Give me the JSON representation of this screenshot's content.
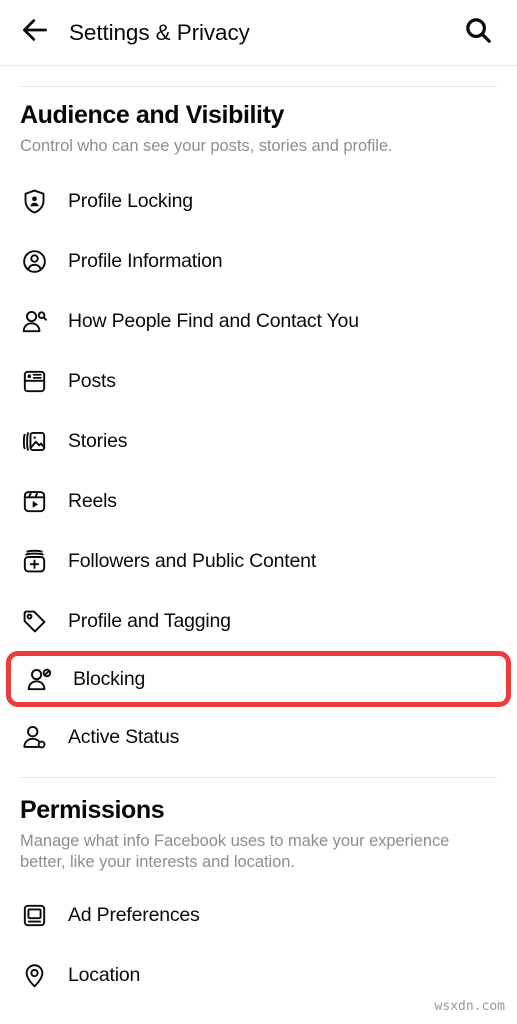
{
  "header": {
    "title": "Settings & Privacy",
    "back_icon": "arrow-left-icon",
    "search_icon": "search-icon"
  },
  "sections": [
    {
      "id": "audience-and-visibility",
      "title": "Audience and Visibility",
      "description": "Control who can see your posts, stories and profile.",
      "items": [
        {
          "label": "Profile Locking",
          "icon": "shield-person-icon",
          "highlighted": false
        },
        {
          "label": "Profile Information",
          "icon": "person-circle-icon",
          "highlighted": false
        },
        {
          "label": "How People Find and Contact You",
          "icon": "person-search-icon",
          "highlighted": false
        },
        {
          "label": "Posts",
          "icon": "posts-icon",
          "highlighted": false
        },
        {
          "label": "Stories",
          "icon": "stories-photo-stack-icon",
          "highlighted": false
        },
        {
          "label": "Reels",
          "icon": "reels-play-icon",
          "highlighted": false
        },
        {
          "label": "Followers and Public Content",
          "icon": "followers-plus-icon",
          "highlighted": false
        },
        {
          "label": "Profile and Tagging",
          "icon": "tag-icon",
          "highlighted": false
        },
        {
          "label": "Blocking",
          "icon": "person-block-icon",
          "highlighted": true
        },
        {
          "label": "Active Status",
          "icon": "person-active-dot-icon",
          "highlighted": false
        }
      ]
    },
    {
      "id": "permissions",
      "title": "Permissions",
      "description": "Manage what info Facebook uses to make your experience better, like your interests and location.",
      "items": [
        {
          "label": "Ad Preferences",
          "icon": "ad-preferences-monitor-icon",
          "highlighted": false
        },
        {
          "label": "Location",
          "icon": "location-pin-icon",
          "highlighted": false
        }
      ]
    }
  ],
  "colors": {
    "highlight_red": "#ee3b3b",
    "text_primary": "#0b0b0c",
    "text_secondary": "#8b8e93",
    "divider": "#e4e6e9",
    "background": "#ffffff"
  },
  "watermark": "wsxdn.com"
}
